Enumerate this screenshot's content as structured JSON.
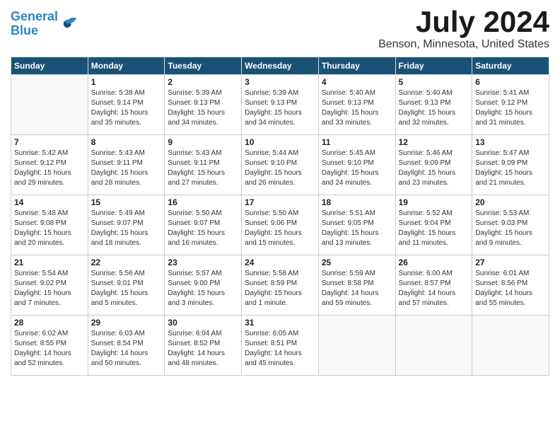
{
  "header": {
    "logo_line1": "General",
    "logo_line2": "Blue",
    "month_year": "July 2024",
    "location": "Benson, Minnesota, United States"
  },
  "weekdays": [
    "Sunday",
    "Monday",
    "Tuesday",
    "Wednesday",
    "Thursday",
    "Friday",
    "Saturday"
  ],
  "weeks": [
    [
      {
        "day": "",
        "info": ""
      },
      {
        "day": "1",
        "info": "Sunrise: 5:38 AM\nSunset: 9:14 PM\nDaylight: 15 hours\nand 35 minutes."
      },
      {
        "day": "2",
        "info": "Sunrise: 5:39 AM\nSunset: 9:13 PM\nDaylight: 15 hours\nand 34 minutes."
      },
      {
        "day": "3",
        "info": "Sunrise: 5:39 AM\nSunset: 9:13 PM\nDaylight: 15 hours\nand 34 minutes."
      },
      {
        "day": "4",
        "info": "Sunrise: 5:40 AM\nSunset: 9:13 PM\nDaylight: 15 hours\nand 33 minutes."
      },
      {
        "day": "5",
        "info": "Sunrise: 5:40 AM\nSunset: 9:13 PM\nDaylight: 15 hours\nand 32 minutes."
      },
      {
        "day": "6",
        "info": "Sunrise: 5:41 AM\nSunset: 9:12 PM\nDaylight: 15 hours\nand 31 minutes."
      }
    ],
    [
      {
        "day": "7",
        "info": "Sunrise: 5:42 AM\nSunset: 9:12 PM\nDaylight: 15 hours\nand 29 minutes."
      },
      {
        "day": "8",
        "info": "Sunrise: 5:43 AM\nSunset: 9:11 PM\nDaylight: 15 hours\nand 28 minutes."
      },
      {
        "day": "9",
        "info": "Sunrise: 5:43 AM\nSunset: 9:11 PM\nDaylight: 15 hours\nand 27 minutes."
      },
      {
        "day": "10",
        "info": "Sunrise: 5:44 AM\nSunset: 9:10 PM\nDaylight: 15 hours\nand 26 minutes."
      },
      {
        "day": "11",
        "info": "Sunrise: 5:45 AM\nSunset: 9:10 PM\nDaylight: 15 hours\nand 24 minutes."
      },
      {
        "day": "12",
        "info": "Sunrise: 5:46 AM\nSunset: 9:09 PM\nDaylight: 15 hours\nand 23 minutes."
      },
      {
        "day": "13",
        "info": "Sunrise: 5:47 AM\nSunset: 9:09 PM\nDaylight: 15 hours\nand 21 minutes."
      }
    ],
    [
      {
        "day": "14",
        "info": "Sunrise: 5:48 AM\nSunset: 9:08 PM\nDaylight: 15 hours\nand 20 minutes."
      },
      {
        "day": "15",
        "info": "Sunrise: 5:49 AM\nSunset: 9:07 PM\nDaylight: 15 hours\nand 18 minutes."
      },
      {
        "day": "16",
        "info": "Sunrise: 5:50 AM\nSunset: 9:07 PM\nDaylight: 15 hours\nand 16 minutes."
      },
      {
        "day": "17",
        "info": "Sunrise: 5:50 AM\nSunset: 9:06 PM\nDaylight: 15 hours\nand 15 minutes."
      },
      {
        "day": "18",
        "info": "Sunrise: 5:51 AM\nSunset: 9:05 PM\nDaylight: 15 hours\nand 13 minutes."
      },
      {
        "day": "19",
        "info": "Sunrise: 5:52 AM\nSunset: 9:04 PM\nDaylight: 15 hours\nand 11 minutes."
      },
      {
        "day": "20",
        "info": "Sunrise: 5:53 AM\nSunset: 9:03 PM\nDaylight: 15 hours\nand 9 minutes."
      }
    ],
    [
      {
        "day": "21",
        "info": "Sunrise: 5:54 AM\nSunset: 9:02 PM\nDaylight: 15 hours\nand 7 minutes."
      },
      {
        "day": "22",
        "info": "Sunrise: 5:56 AM\nSunset: 9:01 PM\nDaylight: 15 hours\nand 5 minutes."
      },
      {
        "day": "23",
        "info": "Sunrise: 5:57 AM\nSunset: 9:00 PM\nDaylight: 15 hours\nand 3 minutes."
      },
      {
        "day": "24",
        "info": "Sunrise: 5:58 AM\nSunset: 8:59 PM\nDaylight: 15 hours\nand 1 minute."
      },
      {
        "day": "25",
        "info": "Sunrise: 5:59 AM\nSunset: 8:58 PM\nDaylight: 14 hours\nand 59 minutes."
      },
      {
        "day": "26",
        "info": "Sunrise: 6:00 AM\nSunset: 8:57 PM\nDaylight: 14 hours\nand 57 minutes."
      },
      {
        "day": "27",
        "info": "Sunrise: 6:01 AM\nSunset: 8:56 PM\nDaylight: 14 hours\nand 55 minutes."
      }
    ],
    [
      {
        "day": "28",
        "info": "Sunrise: 6:02 AM\nSunset: 8:55 PM\nDaylight: 14 hours\nand 52 minutes."
      },
      {
        "day": "29",
        "info": "Sunrise: 6:03 AM\nSunset: 8:54 PM\nDaylight: 14 hours\nand 50 minutes."
      },
      {
        "day": "30",
        "info": "Sunrise: 6:04 AM\nSunset: 8:52 PM\nDaylight: 14 hours\nand 48 minutes."
      },
      {
        "day": "31",
        "info": "Sunrise: 6:05 AM\nSunset: 8:51 PM\nDaylight: 14 hours\nand 45 minutes."
      },
      {
        "day": "",
        "info": ""
      },
      {
        "day": "",
        "info": ""
      },
      {
        "day": "",
        "info": ""
      }
    ]
  ]
}
